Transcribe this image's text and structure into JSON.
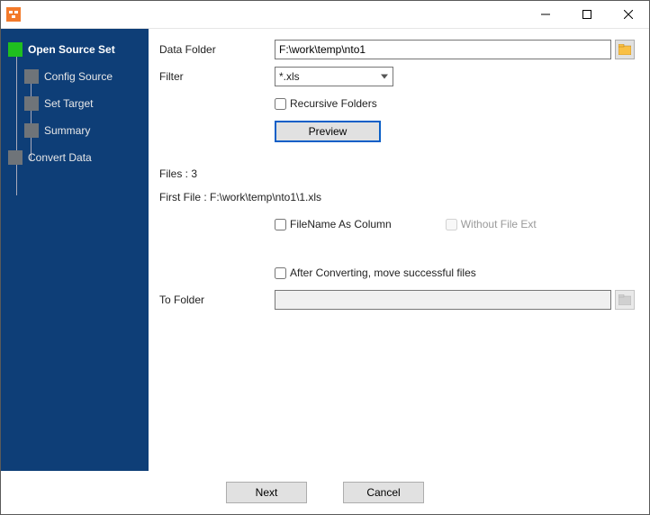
{
  "sidebar": {
    "items": [
      {
        "label": "Open Source Set",
        "active": true
      },
      {
        "label": "Config Source",
        "active": false
      },
      {
        "label": "Set Target",
        "active": false
      },
      {
        "label": "Summary",
        "active": false
      },
      {
        "label": "Convert Data",
        "active": false
      }
    ]
  },
  "form": {
    "data_folder_label": "Data Folder",
    "data_folder_value": "F:\\work\\temp\\nto1",
    "filter_label": "Filter",
    "filter_value": "*.xls",
    "recursive_label": "Recursive Folders",
    "preview_label": "Preview",
    "files_count_label": "Files : 3",
    "first_file_label": "First File : F:\\work\\temp\\nto1\\1.xls",
    "filename_as_column_label": "FileName As Column",
    "without_ext_label": "Without File Ext",
    "after_convert_label": "After Converting, move successful files",
    "to_folder_label": "To Folder",
    "to_folder_value": ""
  },
  "footer": {
    "next_label": "Next",
    "cancel_label": "Cancel"
  }
}
